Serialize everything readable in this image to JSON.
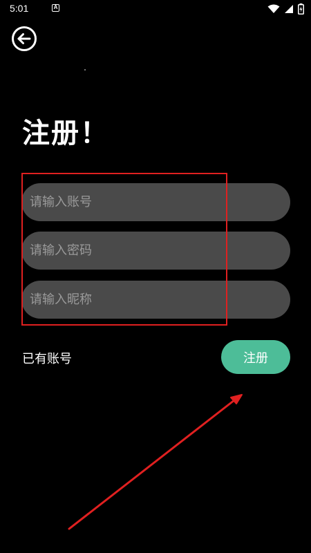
{
  "status_bar": {
    "time": "5:01",
    "notification_icon": "A"
  },
  "header": {
    "back_icon": "back-arrow-circle-icon"
  },
  "page": {
    "title": "注册！"
  },
  "form": {
    "account_placeholder": "请输入账号",
    "account_value": "",
    "password_placeholder": "请输入密码",
    "password_value": "",
    "nickname_placeholder": "请输入昵称",
    "nickname_value": ""
  },
  "actions": {
    "have_account_label": "已有账号",
    "register_label": "注册"
  },
  "colors": {
    "background": "#000000",
    "field_background": "#4a4a4a",
    "register_button": "#4dbd98",
    "annotation": "#e02020"
  }
}
